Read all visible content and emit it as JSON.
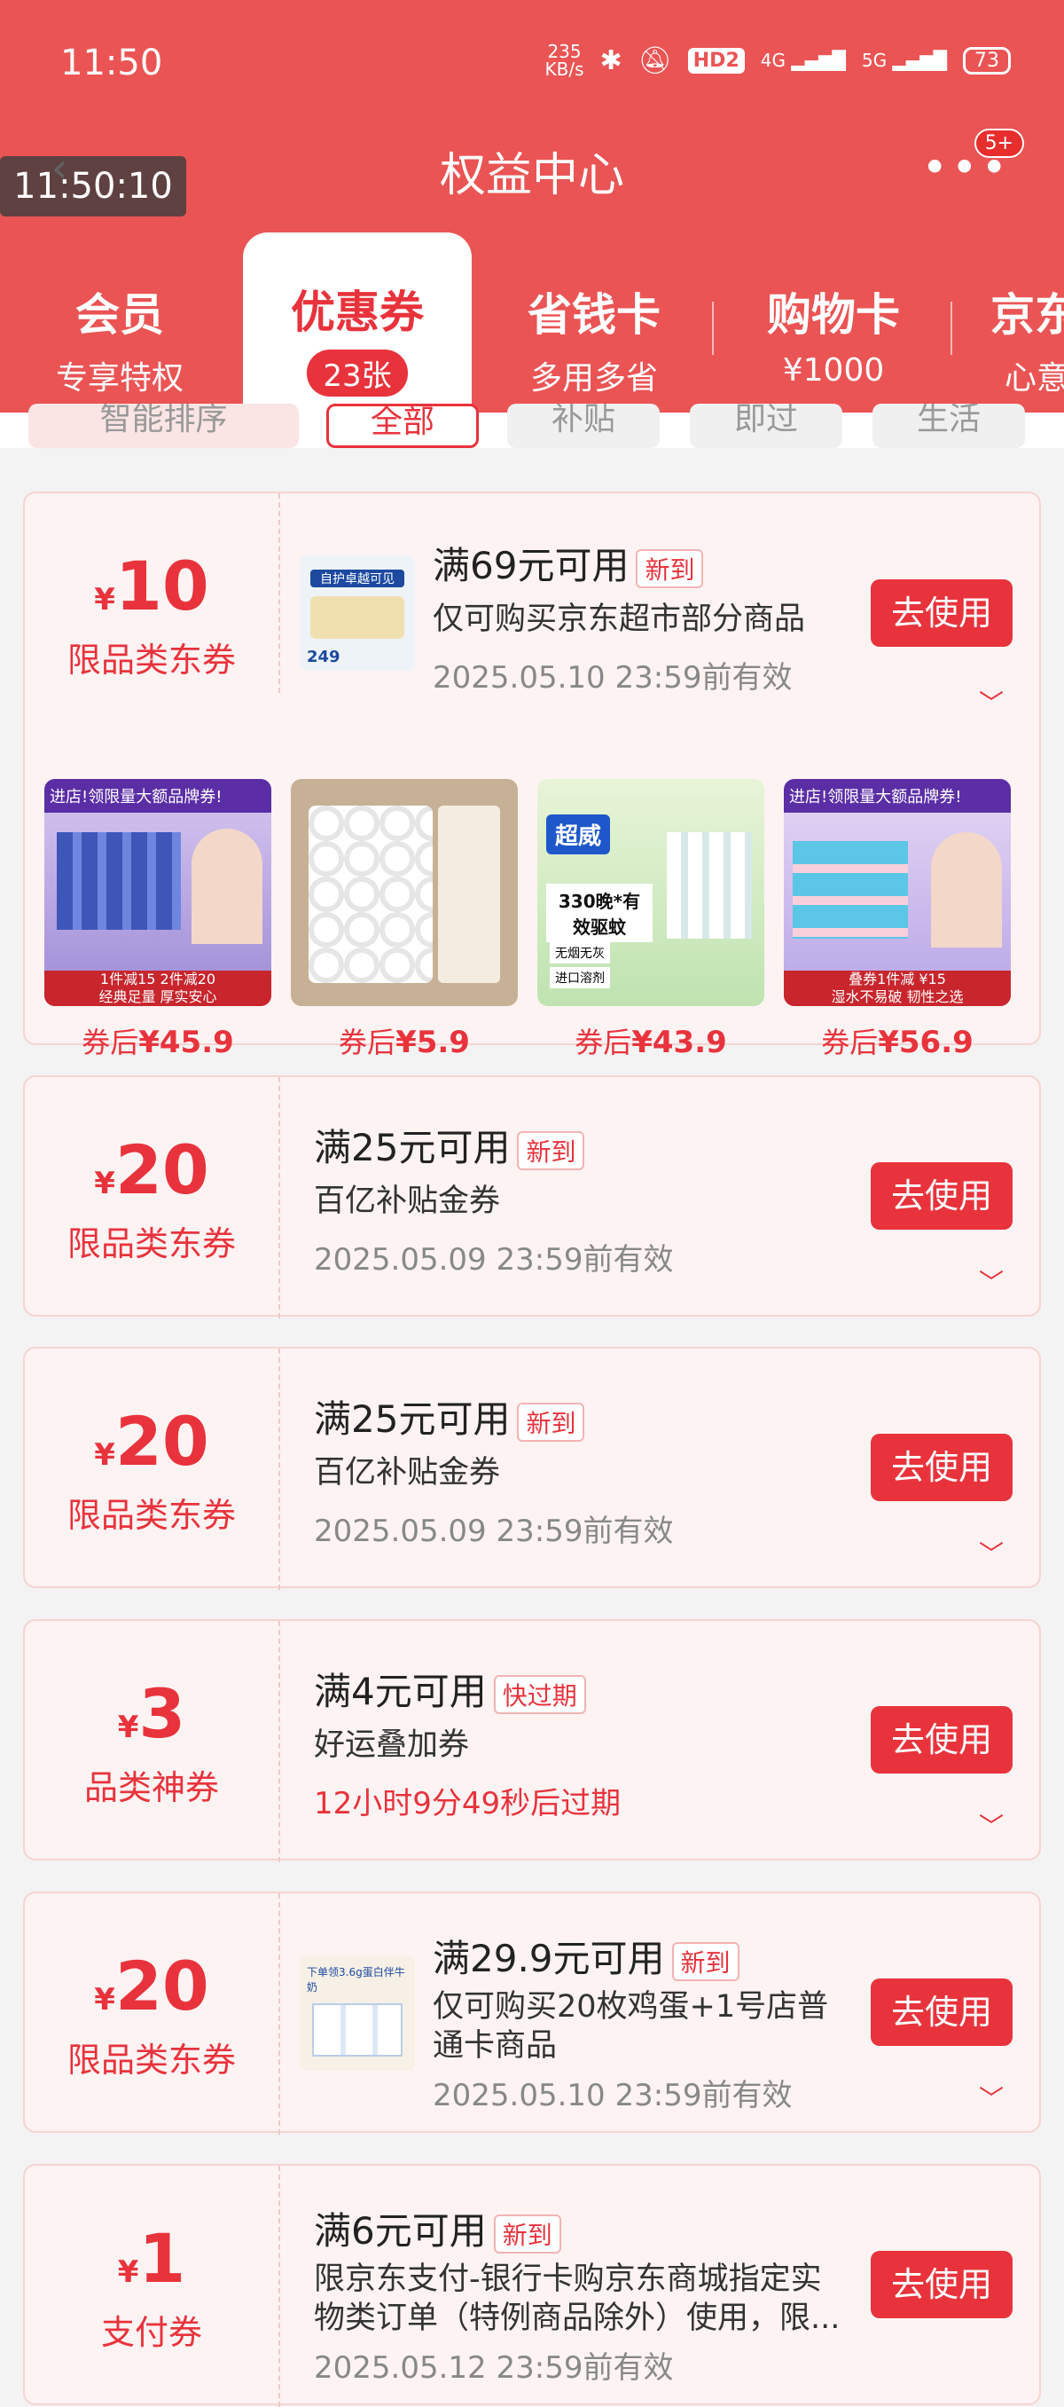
{
  "status": {
    "time": "11:50",
    "speed": "235\nKB/s",
    "hd": "HD2",
    "net1": "4G",
    "net2": "5G",
    "battery": "73"
  },
  "overlay_time": "11:50:10",
  "nav": {
    "title": "权益中心",
    "badge": "5+"
  },
  "tabs": [
    {
      "title": "会员",
      "sub": "专享特权"
    },
    {
      "title": "优惠券",
      "sub": "23张"
    },
    {
      "title": "省钱卡",
      "sub": "多用多省"
    },
    {
      "title": "购物卡",
      "sub": "¥1000"
    },
    {
      "title": "京东",
      "sub": "心意"
    }
  ],
  "filters": [
    "智能排序",
    "全部",
    "补贴",
    "即过",
    "生活"
  ],
  "coupons": [
    {
      "symbol": "¥",
      "amount": "10",
      "category": "限品类东券",
      "condition": "满69元可用",
      "tag": "新到",
      "desc": "仅可购买京东超市部分商品",
      "valid": "2025.05.10 23:59前有效",
      "button": "去使用"
    },
    {
      "symbol": "¥",
      "amount": "20",
      "category": "限品类东券",
      "condition": "满25元可用",
      "tag": "新到",
      "desc": "百亿补贴金券",
      "valid": "2025.05.09 23:59前有效",
      "button": "去使用"
    },
    {
      "symbol": "¥",
      "amount": "20",
      "category": "限品类东券",
      "condition": "满25元可用",
      "tag": "新到",
      "desc": "百亿补贴金券",
      "valid": "2025.05.09 23:59前有效",
      "button": "去使用"
    },
    {
      "symbol": "¥",
      "amount": "3",
      "category": "品类神券",
      "condition": "满4元可用",
      "tag": "快过期",
      "desc": "好运叠加券",
      "valid": "12小时9分49秒后过期",
      "button": "去使用"
    },
    {
      "symbol": "¥",
      "amount": "20",
      "category": "限品类东券",
      "condition": "满29.9元可用",
      "tag": "新到",
      "desc": "仅可购买20枚鸡蛋+1号店普通卡商品",
      "desc_l1": "仅可购买20枚鸡蛋+1号店普",
      "desc_l2": "通卡商品",
      "valid": "2025.05.10 23:59前有效",
      "button": "去使用"
    },
    {
      "symbol": "¥",
      "amount": "1",
      "category": "支付券",
      "condition": "满6元可用",
      "tag": "新到",
      "desc_l1": "限京东支付-银行卡购京东商城指定实",
      "desc_l2": "物类订单（特例商品除外）使用，限...",
      "valid": "2025.05.12 23:59前有效",
      "button": "去使用"
    }
  ],
  "products": [
    {
      "label": "券后",
      "price": "¥45.9",
      "img_text": "进店!领限量大额品牌券!",
      "promo": "1件减15 2件减20",
      "promo2": "经典足量 厚实安心"
    },
    {
      "label": "券后",
      "price": "¥5.9"
    },
    {
      "label": "券后",
      "price": "¥43.9",
      "img_text": "超威",
      "promo": "330晚*有效驱蚊",
      "promo2": "无烟无灰",
      "promo3": "进口溶剂"
    },
    {
      "label": "券后",
      "price": "¥56.9",
      "img_text": "进店!领限量大额品牌券!",
      "promo": "叠券1件减 ¥15",
      "promo2": "湿水不易破 韧性之选"
    }
  ],
  "thumb1": {
    "line1": "自护卓越可见",
    "line2": "249"
  },
  "thumb5": {
    "line1": "下单领3.6g蛋白伴牛奶"
  },
  "colors": {
    "primary": "#ea5454",
    "accent": "#e8333c"
  }
}
